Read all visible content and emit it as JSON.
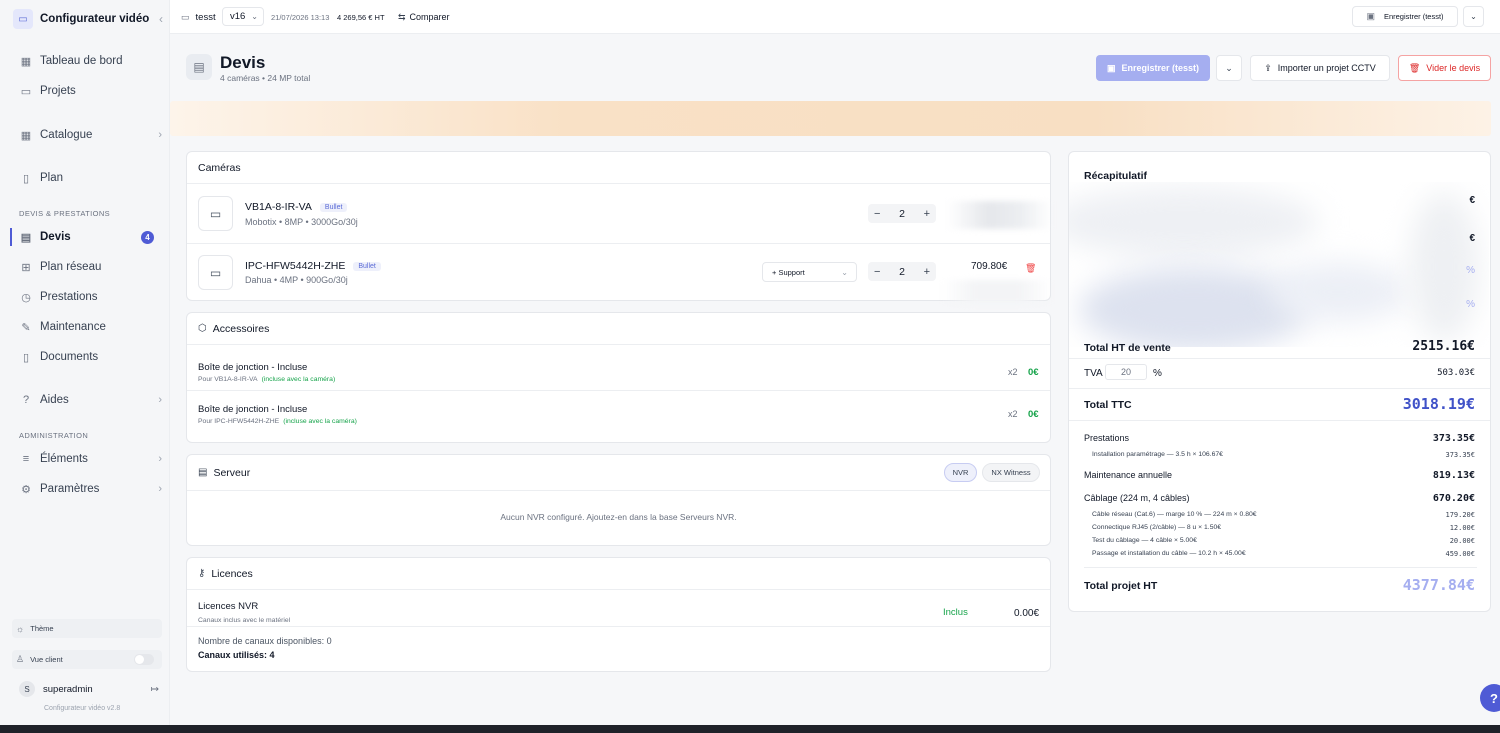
{
  "sidebar": {
    "brand": "Configurateur vidéo",
    "items_top": [
      {
        "label": "Tableau de bord"
      },
      {
        "label": "Projets"
      },
      {
        "label": "Catalogue"
      },
      {
        "label": "Plan"
      }
    ],
    "section_devis": "DEVIS & PRESTATIONS",
    "items_devis": [
      {
        "label": "Devis",
        "badge": "4"
      },
      {
        "label": "Plan réseau"
      },
      {
        "label": "Prestations"
      },
      {
        "label": "Maintenance"
      },
      {
        "label": "Documents"
      },
      {
        "label": "Aides"
      }
    ],
    "section_admin": "ADMINISTRATION",
    "items_admin": [
      {
        "label": "Éléments"
      },
      {
        "label": "Paramètres"
      }
    ],
    "theme_label": "Thème",
    "client_view_label": "Vue client",
    "user_initial": "S",
    "user_name": "superadmin",
    "version": "Configurateur vidéo v2.8"
  },
  "topbar": {
    "project": "tesst",
    "version": "v16",
    "date": "21/07/2026 13:13",
    "amount": "4 269,56 € HT",
    "compare": "Comparer",
    "save": "Enregistrer (tesst)"
  },
  "page": {
    "title": "Devis",
    "subtitle": "4 caméras • 24 MP total",
    "save_btn": "Enregistrer (tesst)",
    "import_btn": "Importer un projet CCTV",
    "clear_btn": "Vider le devis"
  },
  "cameras": {
    "title": "Caméras",
    "items": [
      {
        "name": "VB1A-8-IR-VA",
        "tag": "Bullet",
        "meta": "Mobotix • 8MP • 3000Go/30j",
        "qty": "2"
      },
      {
        "name": "IPC-HFW5442H-ZHE",
        "tag": "Bullet",
        "meta": "Dahua • 4MP • 900Go/30j",
        "qty": "2",
        "support": "+ Support",
        "price": "709.80€"
      }
    ]
  },
  "accessories": {
    "title": "Accessoires",
    "items": [
      {
        "name": "Boîte de jonction - Incluse",
        "for": "Pour VB1A-8-IR-VA",
        "note": "(incluse avec la caméra)",
        "qty": "x2",
        "price": "0€"
      },
      {
        "name": "Boîte de jonction - Incluse",
        "for": "Pour IPC-HFW5442H-ZHE",
        "note": "(incluse avec la caméra)",
        "qty": "x2",
        "price": "0€"
      }
    ]
  },
  "server": {
    "title": "Serveur",
    "tab_nvr": "NVR",
    "tab_nx": "NX Witness",
    "empty": "Aucun NVR configuré. Ajoutez-en dans la base Serveurs NVR."
  },
  "licences": {
    "title": "Licences",
    "name": "Licences NVR",
    "sub": "Canaux inclus avec le matériel",
    "included": "Inclus",
    "price": "0.00€",
    "channels": "Nombre de canaux disponibles: 0",
    "used": "Canaux utilisés: 4"
  },
  "summary": {
    "title": "Récapitulatif",
    "edge_1": "€",
    "edge_2": "€",
    "edge_3": "%",
    "edge_4": "%",
    "total_ht_label": "Total HT de vente",
    "total_ht": "2515.16€",
    "tva_label": "TVA",
    "tva_value": "20",
    "tva_unit": "%",
    "tva_amount": "503.03€",
    "ttc_label": "Total TTC",
    "ttc": "3018.19€",
    "prestations_label": "Prestations",
    "prestations": "373.35€",
    "install_label": "Installation paramétrage — 3.5 h × 106.67€",
    "install": "373.35€",
    "maintenance_label": "Maintenance annuelle",
    "maintenance": "819.13€",
    "cablage_label": "Câblage (224 m, 4 câbles)",
    "cablage": "670.20€",
    "cable_lines": [
      {
        "label": "Câble réseau (Cat.6) — marge 10 % — 224 m × 0.80€",
        "value": "179.20€"
      },
      {
        "label": "Connectique RJ45 (2/câble) — 8 u × 1.50€",
        "value": "12.00€"
      },
      {
        "label": "Test du câblage — 4 câble × 5.00€",
        "value": "20.00€"
      },
      {
        "label": "Passage et installation du câble — 10.2 h × 45.00€",
        "value": "459.00€"
      }
    ],
    "project_label": "Total projet HT",
    "project_total": "4377.84€"
  },
  "colors": {
    "accent": "#4f5bd5",
    "accent_light": "#a5aef0",
    "danger": "#dc2626",
    "success": "#16a34a"
  }
}
